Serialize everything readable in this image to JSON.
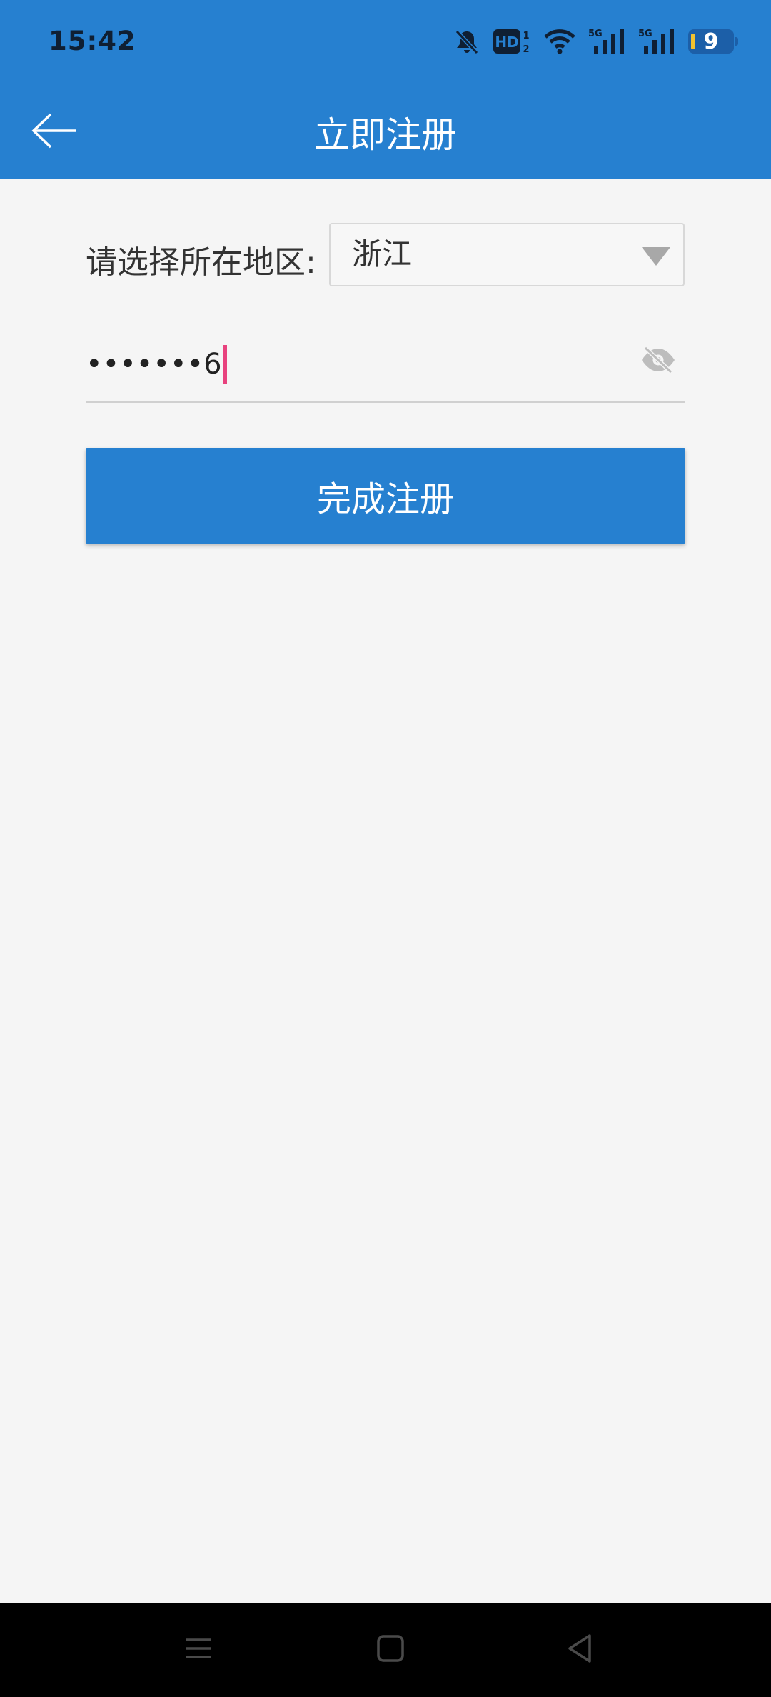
{
  "status_bar": {
    "time": "15:42",
    "battery_level": "9",
    "icons": [
      "bell-off-icon",
      "hd-voice-icon",
      "wifi-icon",
      "signal-5g-icon",
      "signal-5g-icon"
    ]
  },
  "header": {
    "title": "立即注册",
    "back_icon": "arrow-left-icon"
  },
  "form": {
    "region_label": "请选择所在地区:",
    "region_selected": "浙江",
    "password_value": "•••••••6",
    "password_toggle_icon": "eye-off-icon",
    "submit_label": "完成注册"
  },
  "nav_bar": {
    "buttons": [
      "menu-icon",
      "home-icon",
      "back-icon"
    ]
  },
  "colors": {
    "primary": "#2680d0",
    "background": "#f5f5f5",
    "caret": "#e8427e"
  }
}
